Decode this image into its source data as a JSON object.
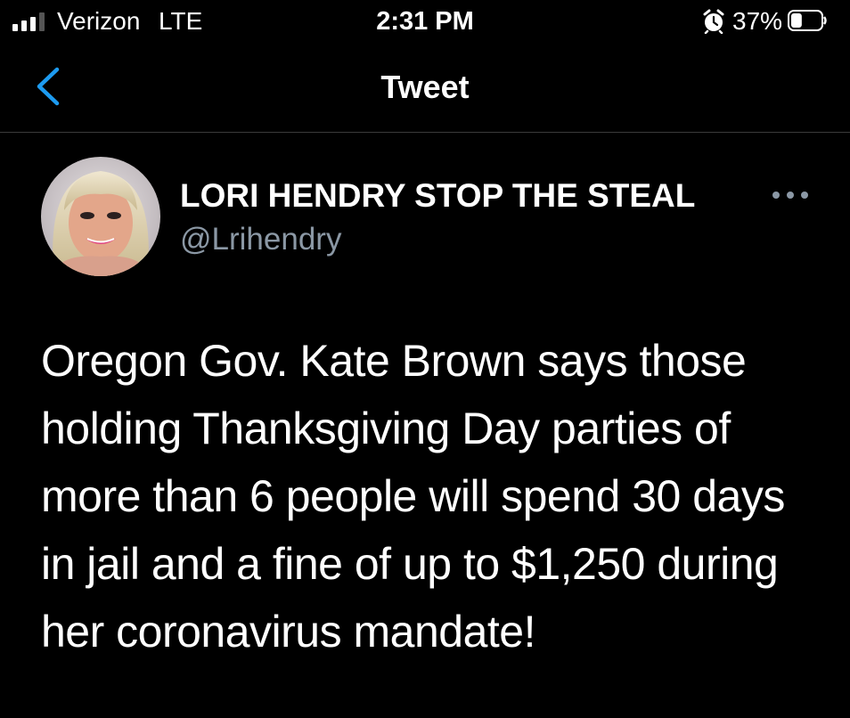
{
  "status_bar": {
    "carrier": "Verizon",
    "network": "LTE",
    "time": "2:31 PM",
    "battery_percent": "37%",
    "battery_level": 0.37,
    "signal_bars": 3,
    "signal_bars_total": 4,
    "icons": [
      "signal-icon",
      "alarm-icon",
      "battery-icon"
    ]
  },
  "header": {
    "title": "Tweet",
    "back_icon": "chevron-left-icon",
    "accent_color": "#1d9bf0"
  },
  "tweet": {
    "display_name": "LORI HENDRY STOP THE STEAL",
    "handle": "@Lrihendry",
    "more_icon": "more-horizontal-icon",
    "text": "Oregon Gov. Kate Brown says those holding Thanksgiving Day parties of more than 6 people will spend 30 days in jail and a fine of up to $1,250 during her coronavirus mandate!"
  },
  "colors": {
    "background": "#000000",
    "text": "#ffffff",
    "secondary_text": "#8b98a5",
    "divider": "#3a3a3a"
  }
}
